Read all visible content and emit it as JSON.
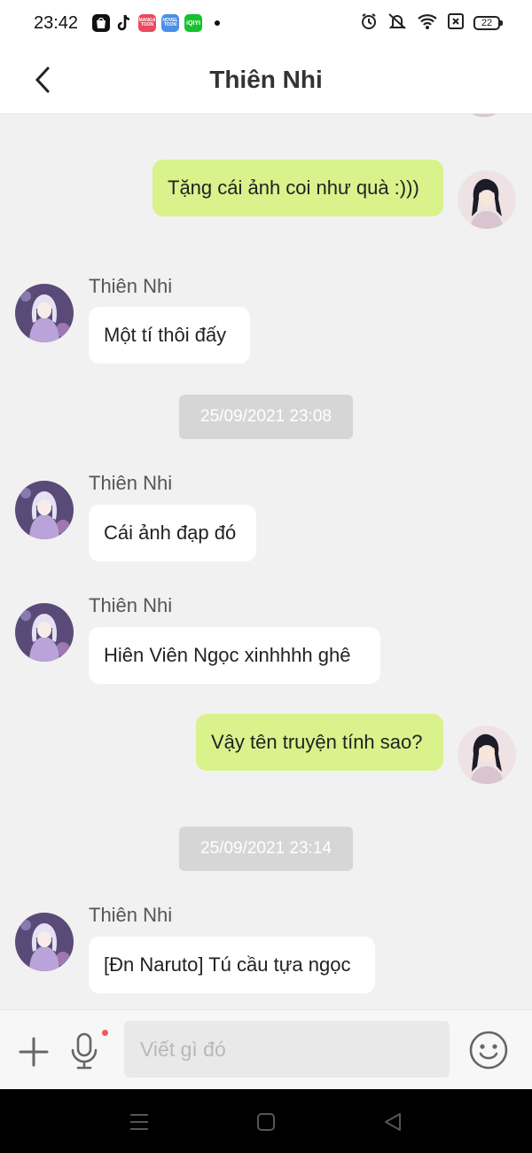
{
  "status_bar": {
    "time": "23:42",
    "battery": "22",
    "app_icons": [
      "shopee-icon",
      "tiktok-icon",
      "mangatoon-icon",
      "noveltoon-icon",
      "iqiyi-icon"
    ],
    "app_labels": {
      "manga": "MANGA TOON",
      "novel": "NOVEL TOON",
      "iqiyi": "iQIYI"
    }
  },
  "header": {
    "title": "Thiên Nhi"
  },
  "messages": [
    {
      "type": "out",
      "text": "Tặng cái ảnh coi như quà :)))"
    },
    {
      "type": "in",
      "sender": "Thiên Nhi",
      "text": "Một tí thôi đấy"
    },
    {
      "type": "time",
      "text": "25/09/2021 23:08"
    },
    {
      "type": "in",
      "sender": "Thiên Nhi",
      "text": "Cái ảnh đạp đó"
    },
    {
      "type": "in",
      "sender": "Thiên Nhi",
      "text": "Hiên Viên Ngọc xinhhhh ghê"
    },
    {
      "type": "out",
      "text": "Vậy tên truyện tính sao?"
    },
    {
      "type": "time",
      "text": "25/09/2021 23:14"
    },
    {
      "type": "in",
      "sender": "Thiên Nhi",
      "text": "[Đn Naruto] Tú cầu tựa ngọc"
    }
  ],
  "input": {
    "placeholder": "Viết gì đó"
  },
  "colors": {
    "outgoing_bubble": "#d9f28c",
    "incoming_bubble": "#ffffff",
    "time_chip": "#d6d6d6",
    "background": "#f1f1f1"
  }
}
